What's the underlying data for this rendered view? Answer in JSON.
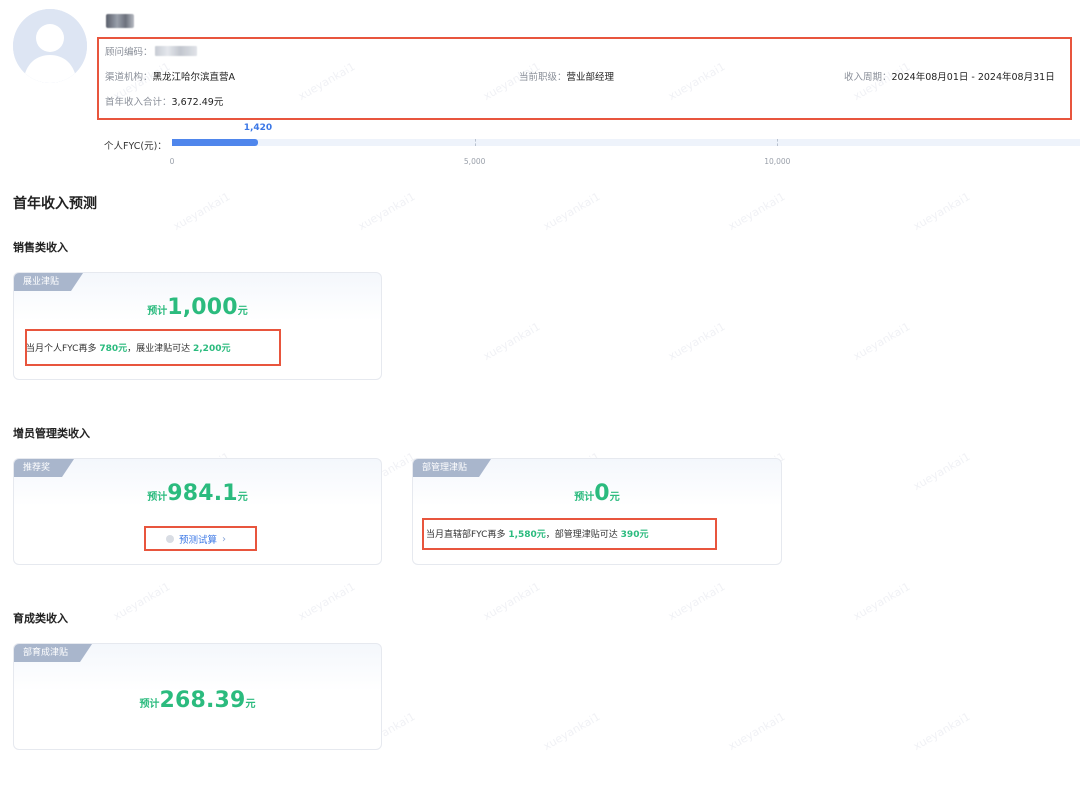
{
  "profile": {
    "avatar_icon": "user-avatar-icon",
    "code_label": "顾问编码：",
    "channel_label": "渠道机构：",
    "channel_value": "黑龙江哈尔滨直营A",
    "rank_label": "当前职级：",
    "rank_value": "营业部经理",
    "period_label": "收入周期：",
    "period_value": "2024年08月01日 - 2024年08月31日",
    "total_label": "首年收入合计：",
    "total_value": "3,672.49元"
  },
  "fyc": {
    "label": "个人FYC(元)：",
    "value": 1420,
    "value_text": "1,420",
    "axis_max": 15000,
    "ticks": [
      {
        "value": 0,
        "label": "0"
      },
      {
        "value": 5000,
        "label": "5,000"
      },
      {
        "value": 10000,
        "label": "10,000"
      }
    ],
    "fill_color": "#4f86ec"
  },
  "page_title": "首年收入预测",
  "sections": {
    "sales": {
      "title": "销售类收入",
      "card": {
        "tag": "展业津贴",
        "prefix": "预计",
        "amount": "1,000",
        "unit": "元",
        "hint_a": "当月个人FYC再多 ",
        "hint_b": "780元",
        "hint_c": "，展业津贴可达 ",
        "hint_d": "2,200元"
      }
    },
    "recruit": {
      "title": "增员管理类收入",
      "card1": {
        "tag": "推荐奖",
        "prefix": "预计",
        "amount": "984.1",
        "unit": "元",
        "link": "预测试算",
        "link_icon": "chevron-right-icon"
      },
      "card2": {
        "tag": "部管理津贴",
        "prefix": "预计",
        "amount": "0",
        "unit": "元",
        "hint_a": "当月直辖部FYC再多 ",
        "hint_b": "1,580元",
        "hint_c": "，部管理津贴可达 ",
        "hint_d": "390元"
      }
    },
    "cultivate": {
      "title": "育成类收入",
      "card": {
        "tag": "部育成津贴",
        "prefix": "预计",
        "amount": "268.39",
        "unit": "元"
      }
    }
  },
  "watermark": "xueyankai1",
  "colors": {
    "accent_green": "#2bbb7e",
    "highlight_red": "#e8553d",
    "link_blue": "#3c78e6"
  }
}
